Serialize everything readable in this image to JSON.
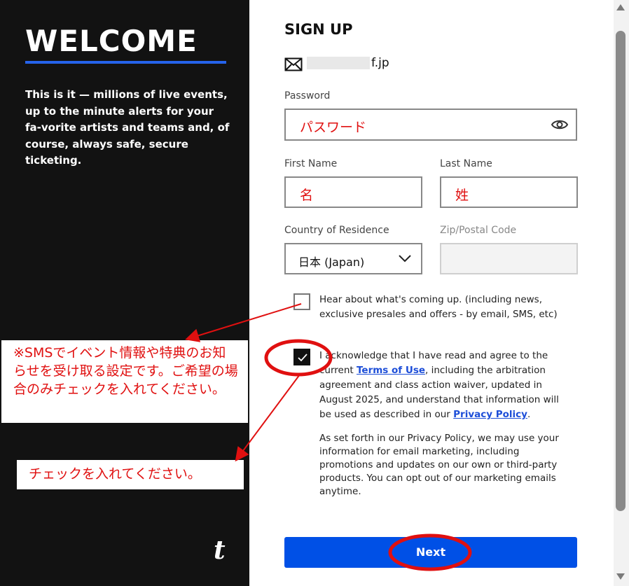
{
  "left": {
    "title": "WELCOME",
    "intro": "This is it — millions of live events, up to the minute alerts for your fa-vorite artists and teams and, of course, always safe, secure ticketing.",
    "logo": "t"
  },
  "form": {
    "title": "SIGN UP",
    "email_suffix": "f.jp",
    "password_label": "Password",
    "password_value": "パスワード",
    "first_name_label": "First Name",
    "first_name_value": "名",
    "last_name_label": "Last Name",
    "last_name_value": "姓",
    "country_label": "Country of Residence",
    "country_value": "日本 (Japan)",
    "zip_label": "Zip/Postal Code",
    "news_text": "Hear about what's coming up. (including news, exclusive presales and offers - by email, SMS, etc)",
    "ack_pre": "I acknowledge that I have read and agree to the current ",
    "terms_link": "Terms of Use",
    "ack_mid": ", including the arbitration agreement and class action waiver, updated in August 2025, and understand that information will be used as described in our ",
    "privacy_link": "Privacy Policy",
    "ack_post": ".",
    "privacy_note": "As set forth in our Privacy Policy, we may use your information for email marketing, including promotions and updates on our own or third-party products. You can opt out of our marketing emails anytime.",
    "next_label": "Next"
  },
  "annotations": {
    "note_sms": "※SMSでイベント情報や特典のお知らせを受け取る設定です。ご希望の場合のみチェックを入れてください。",
    "note_check": "チェックを入れてください。"
  },
  "colors": {
    "accent": "#0050e6",
    "annotation": "#e01010",
    "panel": "#121212"
  },
  "icons": [
    "mail-icon",
    "eye-icon",
    "chevron-down-icon",
    "check-icon",
    "ticketmaster-logo"
  ]
}
